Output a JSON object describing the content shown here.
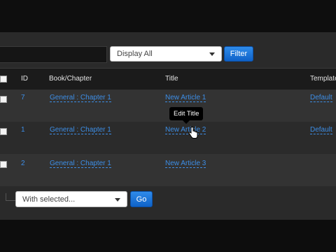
{
  "filter": {
    "search_value": "",
    "display_select": "Display All",
    "filter_button": "Filter"
  },
  "table": {
    "headers": {
      "id": "ID",
      "book_chapter": "Book/Chapter",
      "title": "Title",
      "template": "Template"
    },
    "rows": [
      {
        "id": "7",
        "book_chapter": "General : Chapter 1",
        "title": "New Article 1",
        "template": "Default"
      },
      {
        "id": "1",
        "book_chapter": "General : Chapter 1",
        "title": "New Article 2",
        "template": "Default"
      },
      {
        "id": "2",
        "book_chapter": "General : Chapter 1",
        "title": "New Article 3",
        "template": ""
      }
    ]
  },
  "tooltip": {
    "text": "Edit Title"
  },
  "bulk": {
    "select_value": "With selected...",
    "go_button": "Go"
  },
  "colors": {
    "link": "#3d8ee6",
    "primary_button": "#1a73d9",
    "panel": "#2a2a2a"
  }
}
